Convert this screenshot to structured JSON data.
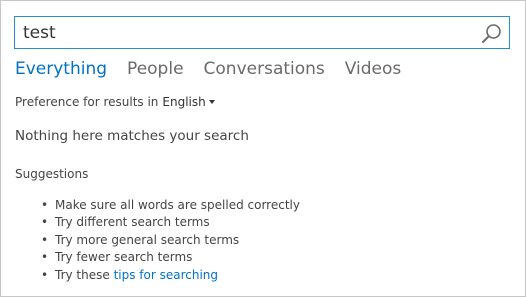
{
  "search": {
    "value": "test",
    "icon": "search-icon"
  },
  "tabs": [
    {
      "label": "Everything",
      "active": true
    },
    {
      "label": "People",
      "active": false
    },
    {
      "label": "Conversations",
      "active": false
    },
    {
      "label": "Videos",
      "active": false
    }
  ],
  "preference": {
    "label": "Preference for results in",
    "language": "English"
  },
  "message": "Nothing here matches your search",
  "suggestions": {
    "title": "Suggestions",
    "bullet": "•",
    "items": [
      "Make sure all words are spelled correctly",
      "Try different search terms",
      "Try more general search terms",
      "Try fewer search terms"
    ],
    "last_prefix": "Try these",
    "last_link": "tips for searching"
  },
  "colors": {
    "accent": "#0072c6",
    "search_border": "#2a8dd4",
    "frame_border": "#c6c6c6"
  }
}
